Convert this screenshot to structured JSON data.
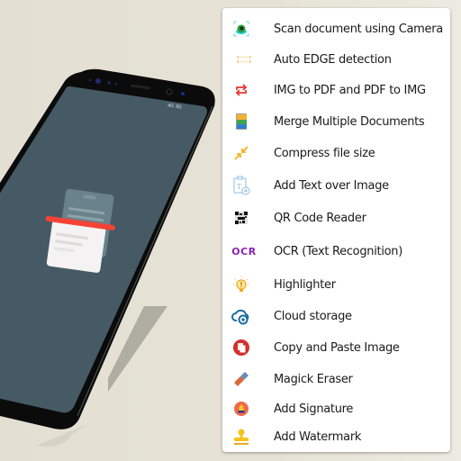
{
  "phone": {
    "status_bar_text": "4G 3G",
    "screen_color": "#455a64",
    "scan_line_color": "#f44336"
  },
  "features": {
    "items": [
      {
        "icon": "camera-scan-icon",
        "label": "Scan document using Camera"
      },
      {
        "icon": "edge-detection-icon",
        "label": "Auto EDGE detection"
      },
      {
        "icon": "convert-arrows-icon",
        "label": "IMG to PDF and PDF to IMG"
      },
      {
        "icon": "merge-documents-icon",
        "label": "Merge Multiple Documents"
      },
      {
        "icon": "compress-icon",
        "label": "Compress file size"
      },
      {
        "icon": "add-text-icon",
        "label": "Add Text over Image"
      },
      {
        "icon": "qr-code-icon",
        "label": "QR Code Reader"
      },
      {
        "icon": "ocr-icon",
        "label": "OCR (Text Recognition)",
        "glyph": "OCR"
      },
      {
        "icon": "lightbulb-icon",
        "label": "Highlighter"
      },
      {
        "icon": "cloud-add-icon",
        "label": "Cloud storage"
      },
      {
        "icon": "copy-paste-icon",
        "label": "Copy and Paste Image"
      },
      {
        "icon": "eraser-icon",
        "label": "Magick Eraser"
      },
      {
        "icon": "signature-pen-icon",
        "label": "Add Signature"
      },
      {
        "icon": "stamp-icon",
        "label": "Add Watermark"
      }
    ]
  }
}
